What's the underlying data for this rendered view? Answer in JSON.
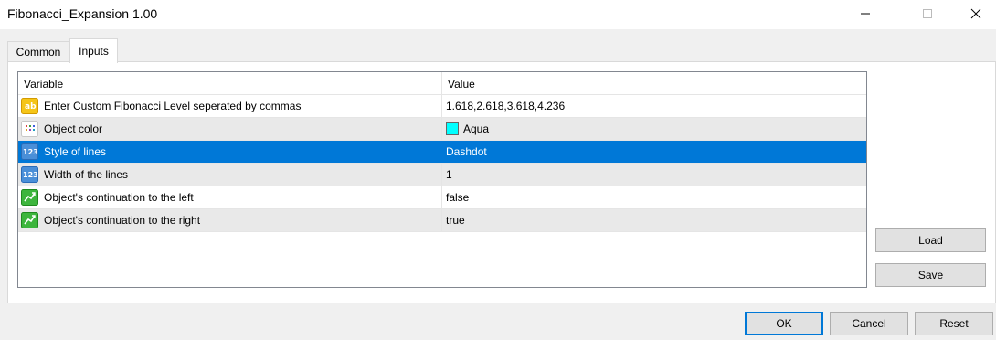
{
  "window": {
    "title": "Fibonacci_Expansion 1.00"
  },
  "tabs": [
    {
      "label": "Common"
    },
    {
      "label": "Inputs",
      "active": true
    }
  ],
  "grid": {
    "columns": [
      "Variable",
      "Value"
    ],
    "rows": [
      {
        "variable": "Enter Custom Fibonacci Level seperated by commas",
        "value": "1.618,2.618,3.618,4.236",
        "icon": "string-ab-icon"
      },
      {
        "variable": "Object color",
        "value": "Aqua",
        "icon": "color-palette-icon",
        "swatch": "#00ffff"
      },
      {
        "variable": "Style of lines",
        "value": "Dashdot",
        "icon": "enum-123-icon",
        "selected": true
      },
      {
        "variable": "Width of the lines",
        "value": "1",
        "icon": "int-123-icon"
      },
      {
        "variable": "Object's continuation to the left",
        "value": "false",
        "icon": "bool-arrow-icon"
      },
      {
        "variable": "Object's continuation to the right",
        "value": "true",
        "icon": "bool-arrow-icon"
      }
    ]
  },
  "side_buttons": {
    "load": "Load",
    "save": "Save"
  },
  "footer_buttons": {
    "ok": "OK",
    "cancel": "Cancel",
    "reset": "Reset"
  },
  "colors": {
    "selection": "#0078d7",
    "alt_row": "#e9e9e9",
    "aqua": "#00ffff"
  }
}
